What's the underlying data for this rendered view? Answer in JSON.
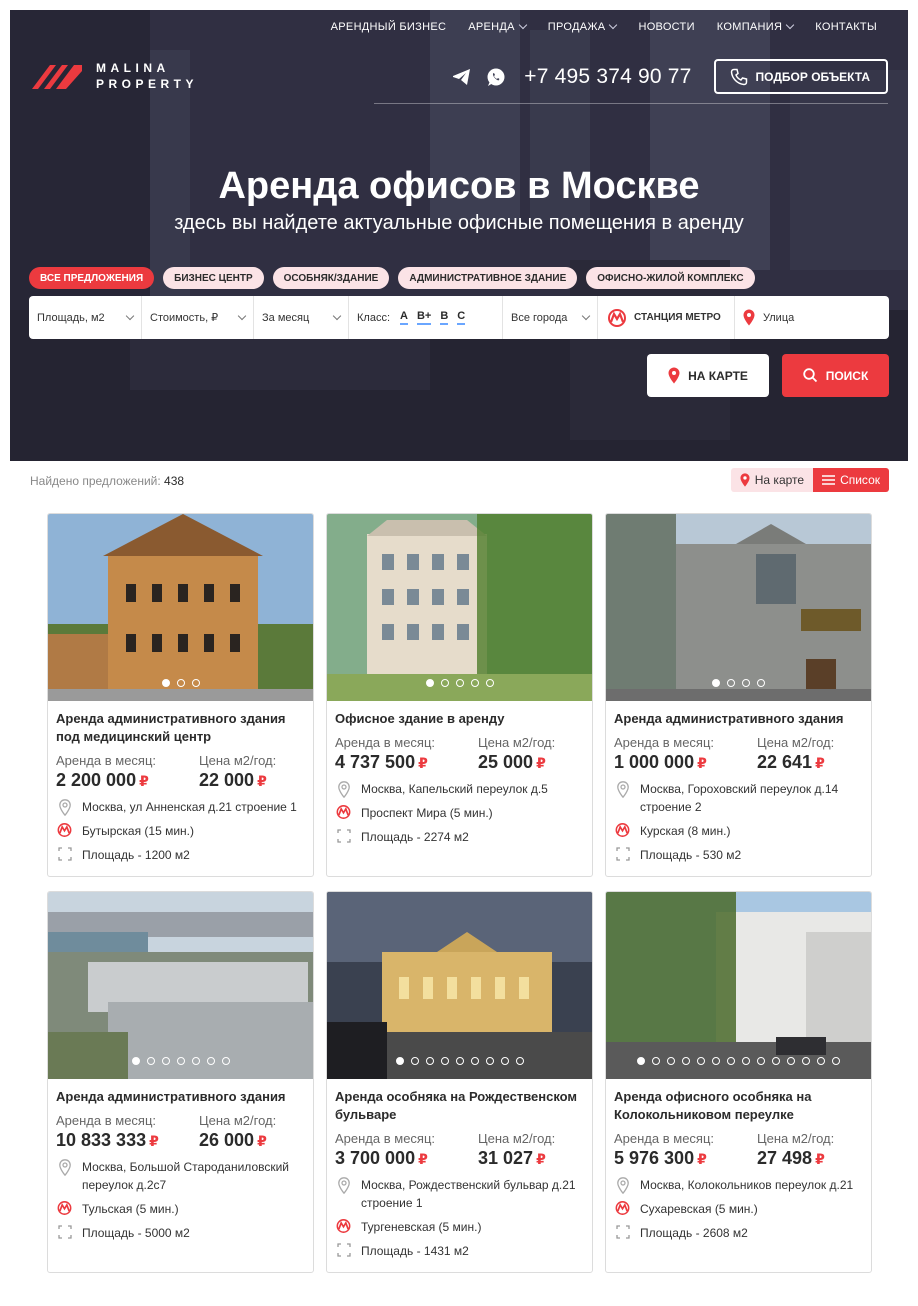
{
  "nav": {
    "items": [
      {
        "label": "Арендный бизнес",
        "dropdown": false
      },
      {
        "label": "Аренда",
        "dropdown": true
      },
      {
        "label": "Продажа",
        "dropdown": true
      },
      {
        "label": "Новости",
        "dropdown": false
      },
      {
        "label": "Компания",
        "dropdown": true
      },
      {
        "label": "Контакты",
        "dropdown": false
      }
    ]
  },
  "logo": {
    "line1": "MALINA",
    "line2": "PROPERTY"
  },
  "contacts": {
    "phone": "+7 495 374 90 77",
    "select_button": "ПОДБОР ОБЪЕКТА"
  },
  "hero": {
    "title": "Аренда офисов в Москве",
    "subtitle": "здесь вы найдете актуальные офисные помещения в аренду"
  },
  "category_pills": [
    {
      "label": "Все предложения",
      "active": true
    },
    {
      "label": "Бизнес центр",
      "active": false
    },
    {
      "label": "Особняк/здание",
      "active": false
    },
    {
      "label": "Административное здание",
      "active": false
    },
    {
      "label": "Офисно-жилой комплекс",
      "active": false
    }
  ],
  "filters": {
    "area": "Площадь, м2",
    "cost": "Стоимость, ₽",
    "period": "За месяц",
    "class_label": "Класс:",
    "classes": [
      "A",
      "B+",
      "B",
      "C"
    ],
    "city": "Все города",
    "metro": "СТАНЦИЯ МЕТРО",
    "street": "Улица"
  },
  "buttons": {
    "map": "НА КАРТЕ",
    "search": "ПОИСК"
  },
  "results": {
    "found_label": "Найдено предложений:",
    "found_count": "438",
    "view_map": "На карте",
    "view_list": "Список"
  },
  "colors": {
    "accent": "#ec3a3f",
    "pill_bg": "#fbe3e6",
    "metro": "#ec3a3f"
  },
  "cards": [
    {
      "title": "Аренда административного здания под медицинский центр",
      "rent_label": "Аренда в месяц:",
      "rent": "2 200 000",
      "price_label": "Цена м2/год:",
      "price": "22 000",
      "address": "Москва, ул Анненская д.21 строение 1",
      "metro": "Бутырская (15 мин.)",
      "area": "Площадь - 1200 м2",
      "dots": 3,
      "active_dot": 0
    },
    {
      "title": "Офисное здание в аренду",
      "rent_label": "Аренда в месяц:",
      "rent": "4 737 500",
      "price_label": "Цена м2/год:",
      "price": "25 000",
      "address": "Москва, Капельский переулок д.5",
      "metro": "Проспект Мира (5 мин.)",
      "area": "Площадь - 2274 м2",
      "dots": 5,
      "active_dot": 0
    },
    {
      "title": "Аренда административного здания",
      "rent_label": "Аренда в месяц:",
      "rent": "1 000 000",
      "price_label": "Цена м2/год:",
      "price": "22 641",
      "address": "Москва, Гороховский переулок д.14 строение 2",
      "metro": "Курская (8 мин.)",
      "area": "Площадь - 530 м2",
      "dots": 4,
      "active_dot": 0
    },
    {
      "title": "Аренда административного здания",
      "rent_label": "Аренда в месяц:",
      "rent": "10 833 333",
      "price_label": "Цена м2/год:",
      "price": "26 000",
      "address": "Москва, Большой Староданиловский переулок д.2с7",
      "metro": "Тульская (5 мин.)",
      "area": "Площадь - 5000 м2",
      "dots": 7,
      "active_dot": 0
    },
    {
      "title": "Аренда особняка на Рождественском бульваре",
      "rent_label": "Аренда в месяц:",
      "rent": "3 700 000",
      "price_label": "Цена м2/год:",
      "price": "31 027",
      "address": "Москва, Рождественский бульвар д.21 строение 1",
      "metro": "Тургеневская (5 мин.)",
      "area": "Площадь - 1431 м2",
      "dots": 9,
      "active_dot": 0
    },
    {
      "title": "Аренда офисного особняка на Колокольниковом переулке",
      "rent_label": "Аренда в месяц:",
      "rent": "5 976 300",
      "price_label": "Цена м2/год:",
      "price": "27 498",
      "address": "Москва, Колокольников переулок д.21",
      "metro": "Сухаревская (5 мин.)",
      "area": "Площадь - 2608 м2",
      "dots": 14,
      "active_dot": 0
    }
  ]
}
